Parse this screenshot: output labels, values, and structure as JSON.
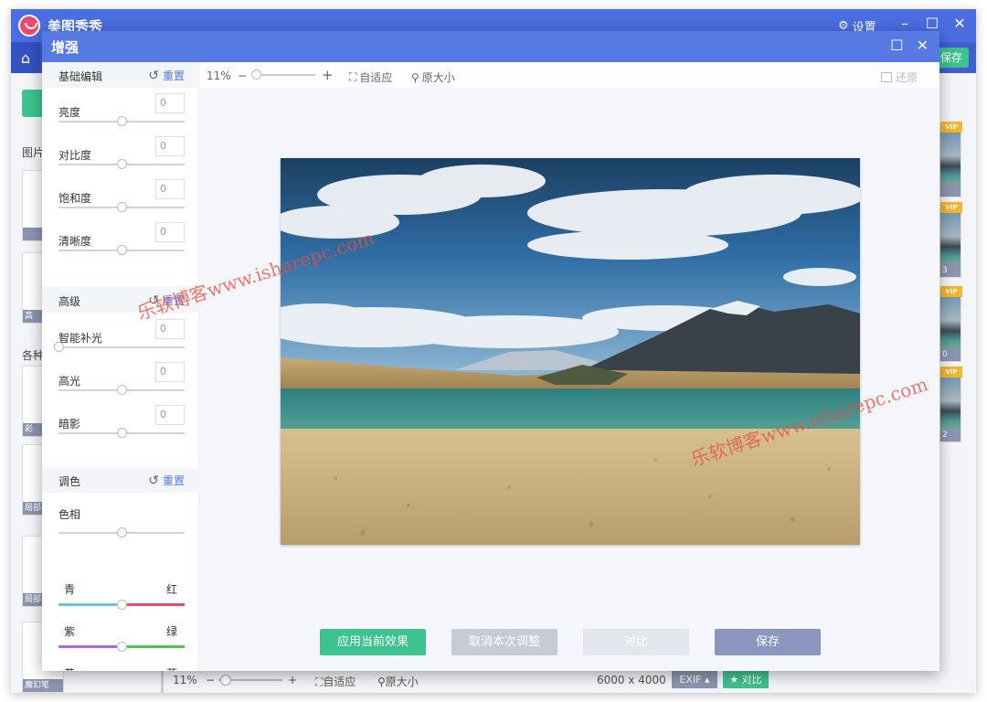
{
  "app": {
    "title": "美图秀秀",
    "settings_label": "设置",
    "save_label": "保存",
    "left_labels": [
      "图片",
      "各种"
    ],
    "left_thumb_captions": [
      "高",
      "",
      "彩",
      "局部",
      "局部",
      "魔幻笔"
    ],
    "right_thumb_nums": [
      "",
      "3",
      "0",
      "2"
    ],
    "vip_label": "VIP"
  },
  "bg_status": {
    "zoom": "11%",
    "fit": "自适应",
    "original": "原大小",
    "resolution": "6000 x 4000",
    "exif": "EXIF",
    "compare": "对比"
  },
  "dialog": {
    "title": "增强",
    "toolbar": {
      "zoom": "11%",
      "minus": "−",
      "plus": "+",
      "fit": "自适应",
      "original": "原大小",
      "restore": "还原"
    },
    "sections": {
      "basic": {
        "title": "基础编辑",
        "reset": "重置",
        "sliders": [
          {
            "label": "亮度",
            "value": "0",
            "pos": 0.5
          },
          {
            "label": "对比度",
            "value": "0",
            "pos": 0.5
          },
          {
            "label": "饱和度",
            "value": "0",
            "pos": 0.5
          },
          {
            "label": "清晰度",
            "value": "0",
            "pos": 0.5
          }
        ]
      },
      "advanced": {
        "title": "高级",
        "reset": "重置",
        "sliders": [
          {
            "label": "智能补光",
            "value": "0",
            "pos": 0.0
          },
          {
            "label": "高光",
            "value": "0",
            "pos": 0.5
          },
          {
            "label": "暗影",
            "value": "0",
            "pos": 0.5
          }
        ]
      },
      "color": {
        "title": "调色",
        "reset": "重置",
        "hue_label": "色相",
        "hue_pos": 0.5,
        "pairs": [
          {
            "left": "青",
            "right": "红",
            "pos": 0.5,
            "c1": "#63c7d6",
            "c2": "#e0506a"
          },
          {
            "left": "紫",
            "right": "绿",
            "pos": 0.5,
            "c1": "#b06ad6",
            "c2": "#56c05a"
          },
          {
            "left": "黄",
            "right": "蓝",
            "pos": 0.5,
            "c1": "#e2d04a",
            "c2": "#3b8fe0"
          }
        ]
      }
    },
    "actions": {
      "apply": "应用当前效果",
      "cancel": "取消本次调整",
      "compare": "对比",
      "save": "保存"
    }
  },
  "watermark": {
    "text": "乐软博客www.isharepc.com"
  },
  "colors": {
    "title_blue": "#5679e4",
    "accent_green": "#3ec28f",
    "link_blue": "#5679e4"
  }
}
